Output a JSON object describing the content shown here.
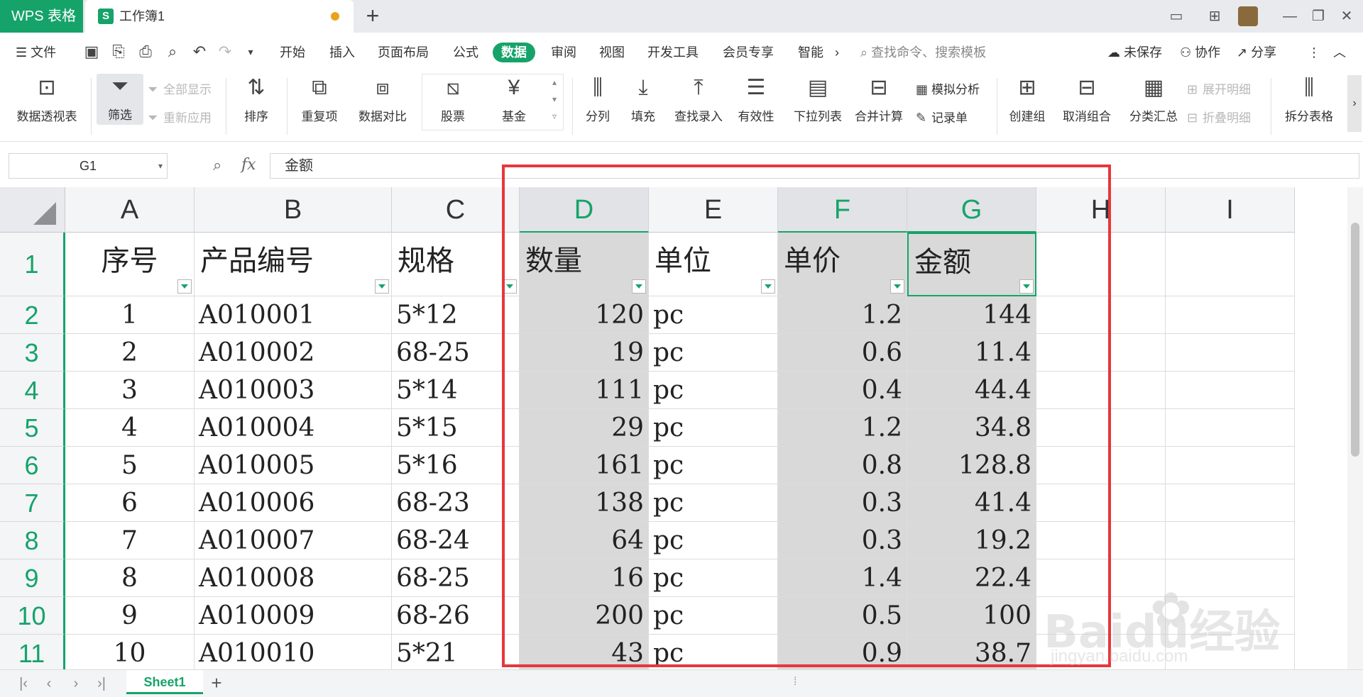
{
  "titlebar": {
    "app_name": "WPS 表格",
    "doc_icon": "S",
    "doc_title": "工作簿1",
    "new_tab": "+"
  },
  "menubar": {
    "file_label": "文件",
    "tabs": [
      "开始",
      "插入",
      "页面布局",
      "公式",
      "数据",
      "审阅",
      "视图",
      "开发工具",
      "会员专享",
      "智能"
    ],
    "active_tab": "数据",
    "more": "›",
    "search_placeholder": "查找命令、搜索模板",
    "unsaved": "未保存",
    "collaborate": "协作",
    "share": "分享"
  },
  "ribbon": {
    "pivot": "数据透视表",
    "filter": "筛选",
    "show_all": "全部显示",
    "reapply": "重新应用",
    "sort": "排序",
    "duplicates": "重复项",
    "compare": "数据对比",
    "stocks": "股票",
    "funds": "基金",
    "split": "分列",
    "fill": "填充",
    "lookup": "查找录入",
    "validity": "有效性",
    "dropdown": "下拉列表",
    "consolidate": "合并计算",
    "what_if": "模拟分析",
    "record": "记录单",
    "group": "创建组",
    "ungroup": "取消组合",
    "subtotal": "分类汇总",
    "expand": "展开明细",
    "collapse": "折叠明细",
    "split_table": "拆分表格"
  },
  "formula_bar": {
    "cell_ref": "G1",
    "fx": "fx",
    "value": "金额"
  },
  "columns": [
    "A",
    "B",
    "C",
    "D",
    "E",
    "F",
    "G",
    "H",
    "I"
  ],
  "rows": [
    "1",
    "2",
    "3",
    "4",
    "5",
    "6",
    "7",
    "8",
    "9",
    "10",
    "11"
  ],
  "table": {
    "headers": [
      "序号",
      "产品编号",
      "规格",
      "数量",
      "单位",
      "单价",
      "金额"
    ],
    "rows": [
      [
        "1",
        "A010001",
        "5*12",
        "120",
        "pc",
        "1.2",
        "144"
      ],
      [
        "2",
        "A010002",
        "68-25",
        "19",
        "pc",
        "0.6",
        "11.4"
      ],
      [
        "3",
        "A010003",
        "5*14",
        "111",
        "pc",
        "0.4",
        "44.4"
      ],
      [
        "4",
        "A010004",
        "5*15",
        "29",
        "pc",
        "1.2",
        "34.8"
      ],
      [
        "5",
        "A010005",
        "5*16",
        "161",
        "pc",
        "0.8",
        "128.8"
      ],
      [
        "6",
        "A010006",
        "68-23",
        "138",
        "pc",
        "0.3",
        "41.4"
      ],
      [
        "7",
        "A010007",
        "68-24",
        "64",
        "pc",
        "0.3",
        "19.2"
      ],
      [
        "8",
        "A010008",
        "68-25",
        "16",
        "pc",
        "1.4",
        "22.4"
      ],
      [
        "9",
        "A010009",
        "68-26",
        "200",
        "pc",
        "0.5",
        "100"
      ],
      [
        "10",
        "A010010",
        "5*21",
        "43",
        "pc",
        "0.9",
        "38.7"
      ]
    ]
  },
  "sheets": {
    "active": "Sheet1",
    "add": "+"
  },
  "watermark": {
    "brand": "Baidu经验",
    "url": "jingyan.baidu.com"
  },
  "colors": {
    "accent": "#16a36a",
    "highlight_box": "#e8363c",
    "selected_fill": "#d9d9d9"
  }
}
